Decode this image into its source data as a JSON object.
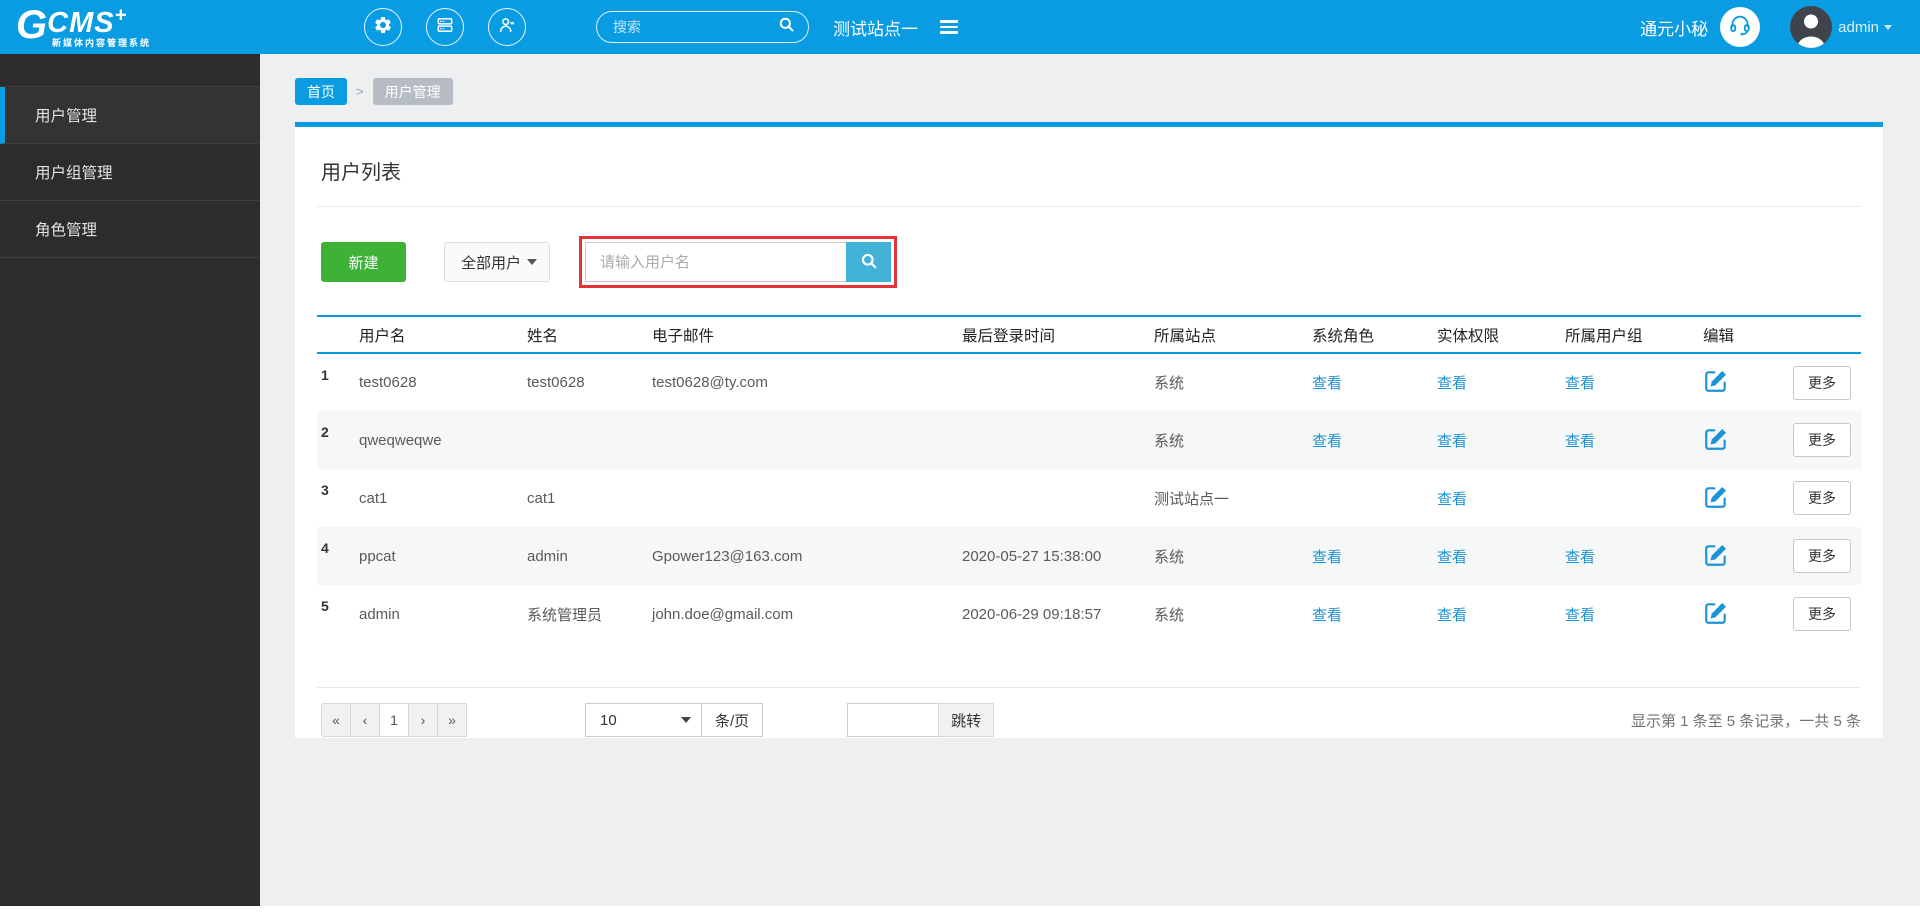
{
  "colors": {
    "header_blue": "#0a9ce2",
    "new_button_green": "#3eb236",
    "search_button_blue": "#42b3d6",
    "annotation_red": "#e23434",
    "link_blue": "#1b93d6",
    "sidebar_dark": "#2c2c2c"
  },
  "header": {
    "logo": {
      "g": "G",
      "rest": "CMS",
      "plus": "+",
      "tagline": "新媒体内容管理系统"
    },
    "search_placeholder": "搜索",
    "site_name": "测试站点一",
    "assistant_label": "通元小秘",
    "username": "admin"
  },
  "sidebar": {
    "items": [
      {
        "label": "用户管理",
        "active": true
      },
      {
        "label": "用户组管理",
        "active": false
      },
      {
        "label": "角色管理",
        "active": false
      }
    ]
  },
  "breadcrumb": {
    "home": "首页",
    "separator": ">",
    "current": "用户管理"
  },
  "main": {
    "title": "用户列表",
    "toolbar": {
      "new_button": "新建",
      "filter_value": "全部用户",
      "search_placeholder": "请输入用户名"
    },
    "table": {
      "headers": [
        "用户名",
        "姓名",
        "电子邮件",
        "最后登录时间",
        "所属站点",
        "系统角色",
        "实体权限",
        "所属用户组",
        "编辑"
      ],
      "more_label": "更多",
      "rows": [
        {
          "index": "1",
          "username": "test0628",
          "name": "test0628",
          "email": "test0628@ty.com",
          "last_login": "",
          "site": "系统",
          "roles": "查看",
          "perms": "查看",
          "groups": "查看"
        },
        {
          "index": "2",
          "username": "qweqweqwe",
          "name": "",
          "email": "",
          "last_login": "",
          "site": "系统",
          "roles": "查看",
          "perms": "查看",
          "groups": "查看"
        },
        {
          "index": "3",
          "username": "cat1",
          "name": "cat1",
          "email": "",
          "last_login": "",
          "site": "测试站点一",
          "roles": "",
          "perms": "查看",
          "groups": ""
        },
        {
          "index": "4",
          "username": "ppcat",
          "name": "admin",
          "email": "Gpower123@163.com",
          "last_login": "2020-05-27 15:38:00",
          "site": "系统",
          "roles": "查看",
          "perms": "查看",
          "groups": "查看"
        },
        {
          "index": "5",
          "username": "admin",
          "name": "系统管理员",
          "email": "john.doe@gmail.com",
          "last_login": "2020-06-29 09:18:57",
          "site": "系统",
          "roles": "查看",
          "perms": "查看",
          "groups": "查看"
        }
      ]
    },
    "pagination": {
      "first": "«",
      "prev": "‹",
      "page": "1",
      "next": "›",
      "last": "»",
      "page_size": "10",
      "per_page_label": "条/页",
      "jump_label": "跳转",
      "summary": "显示第 1 条至 5 条记录，一共 5 条"
    }
  }
}
